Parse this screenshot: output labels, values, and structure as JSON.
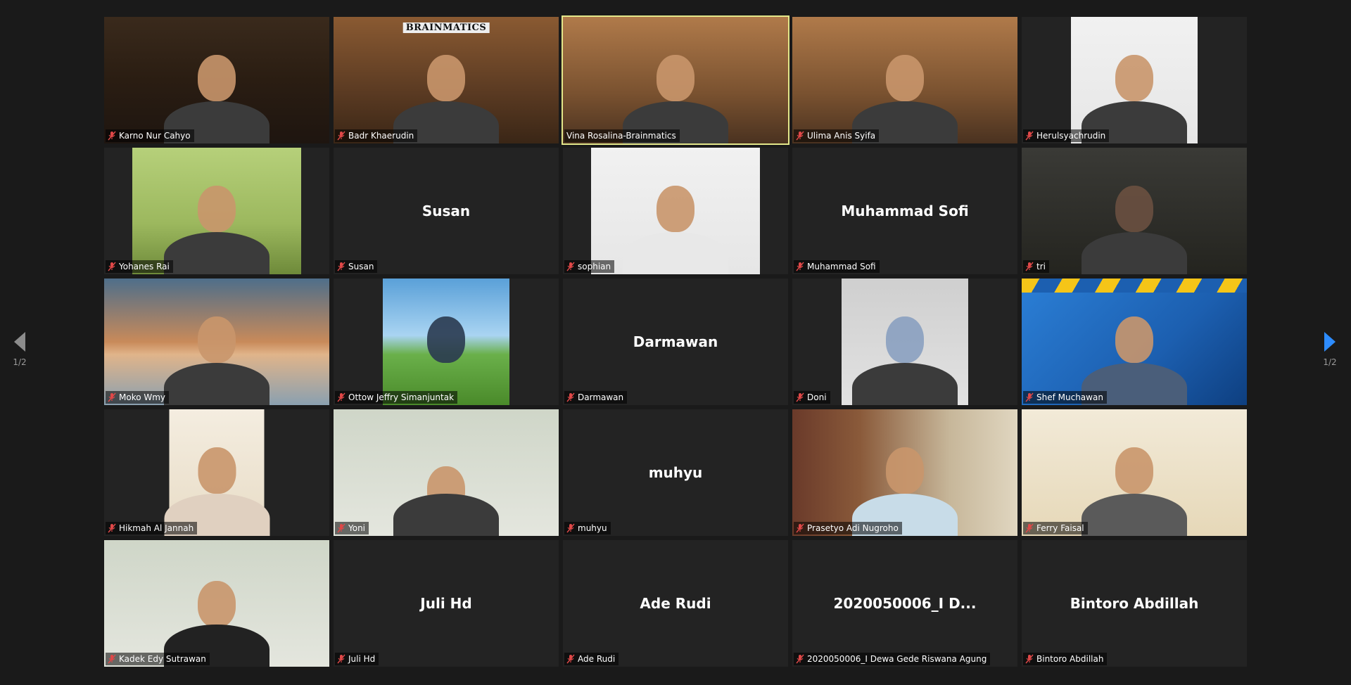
{
  "pagination": {
    "left_label": "1/2",
    "right_label": "1/2"
  },
  "colors": {
    "background": "#1a1a1a",
    "tile": "#232323",
    "active_border": "#e3e78a",
    "next_arrow": "#2d8cff",
    "prev_arrow": "#8c8c8c"
  },
  "icons": {
    "muted_mic": "mic-muted-icon",
    "prev": "chevron-left-icon",
    "next": "chevron-right-icon"
  },
  "brand_text": "BRAINMATICS",
  "participants": [
    {
      "name": "Karno Nur Cahyo",
      "video": true
    },
    {
      "name": "Badr Khaerudin",
      "video": true
    },
    {
      "name": "Vina Rosalina-Brainmatics",
      "video": true,
      "active": true
    },
    {
      "name": "Ulima Anis Syifa",
      "video": true
    },
    {
      "name": "Herulsyachrudin",
      "video": true
    },
    {
      "name": "Yohanes Rai",
      "video": true
    },
    {
      "name": "Susan",
      "video": false,
      "display": "Susan"
    },
    {
      "name": "sophian",
      "video": true
    },
    {
      "name": "Muhammad Sofi",
      "video": false,
      "display": "Muhammad Sofi"
    },
    {
      "name": "tri",
      "video": true
    },
    {
      "name": "Moko Wmy",
      "video": true
    },
    {
      "name": "Ottow Jeffry Simanjuntak",
      "video": true
    },
    {
      "name": "Darmawan",
      "video": false,
      "display": "Darmawan"
    },
    {
      "name": "Doni",
      "video": true
    },
    {
      "name": "Shef Muchawan",
      "video": true
    },
    {
      "name": "Hikmah Al Jannah",
      "video": true
    },
    {
      "name": "Yoni",
      "video": true
    },
    {
      "name": "muhyu",
      "video": false,
      "display": "muhyu"
    },
    {
      "name": "Prasetyo Adi Nugroho",
      "video": true
    },
    {
      "name": "Ferry Faisal",
      "video": true
    },
    {
      "name": "Kadek Edy Sutrawan",
      "video": true
    },
    {
      "name": "Juli Hd",
      "video": false,
      "display": "Juli Hd"
    },
    {
      "name": "Ade Rudi",
      "video": false,
      "display": "Ade Rudi"
    },
    {
      "name": "2020050006_I Dewa Gede Riswana Agung",
      "video": false,
      "display": "2020050006_I D..."
    },
    {
      "name": "Bintoro Abdillah",
      "video": false,
      "display": "Bintoro Abdillah"
    }
  ]
}
